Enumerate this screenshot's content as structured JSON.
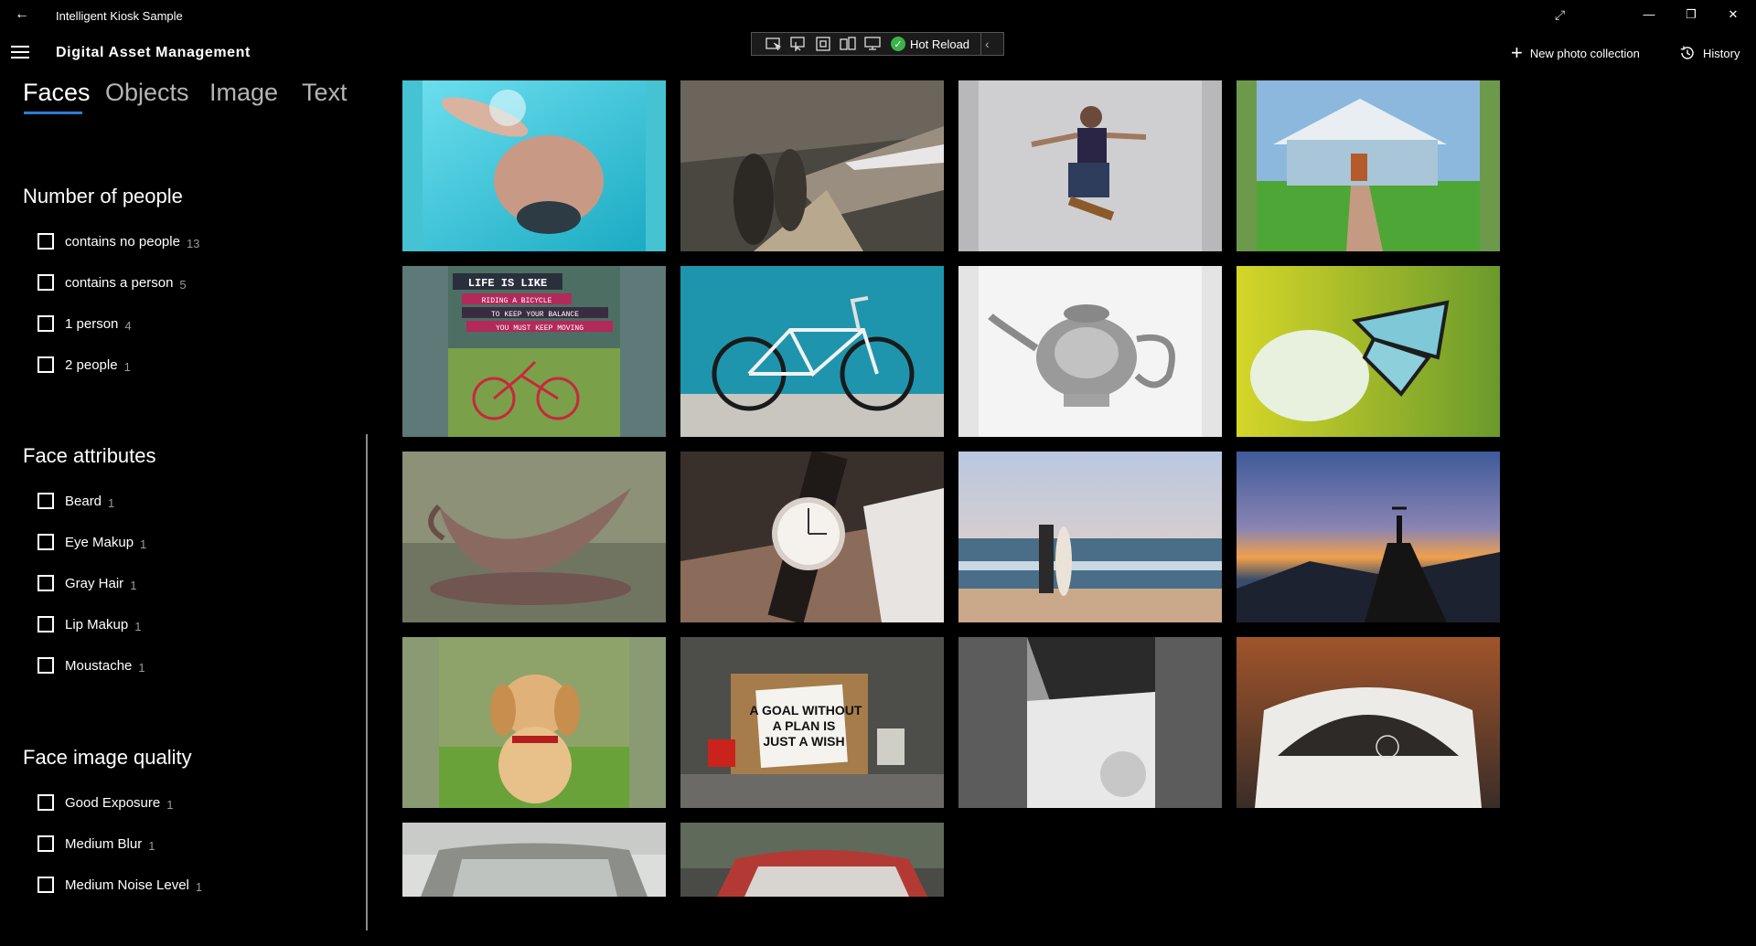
{
  "window": {
    "title": "Intelligent Kiosk Sample",
    "back_icon": "back-arrow-icon",
    "expand_icon": "expand-icon",
    "minimize_icon": "minimize-icon",
    "maximize_icon": "maximize-icon",
    "close_icon": "close-icon"
  },
  "header": {
    "menu_icon": "hamburger-icon",
    "app_title": "Digital Asset Management",
    "hot_reload_label": "Hot Reload",
    "new_collection_label": "New photo collection",
    "history_label": "History"
  },
  "tabs": [
    {
      "label": "Faces",
      "active": true
    },
    {
      "label": "Objects",
      "active": false
    },
    {
      "label": "Image",
      "active": false
    },
    {
      "label": "Text",
      "active": false
    }
  ],
  "filters": {
    "number_of_people": {
      "title": "Number of people",
      "items": [
        {
          "label": "contains no people",
          "count": "13"
        },
        {
          "label": "contains a person",
          "count": "5"
        },
        {
          "label": "1 person",
          "count": "4"
        },
        {
          "label": "2 people",
          "count": "1"
        }
      ]
    },
    "face_attributes": {
      "title": "Face attributes",
      "items": [
        {
          "label": "Beard",
          "count": "1"
        },
        {
          "label": "Eye Makup",
          "count": "1"
        },
        {
          "label": "Gray Hair",
          "count": "1"
        },
        {
          "label": "Lip Makup",
          "count": "1"
        },
        {
          "label": "Moustache",
          "count": "1"
        }
      ]
    },
    "face_image_quality": {
      "title": "Face image quality",
      "items": [
        {
          "label": "Good Exposure",
          "count": "1"
        },
        {
          "label": "Medium Blur",
          "count": "1"
        },
        {
          "label": "Medium Noise Level",
          "count": "1"
        }
      ]
    }
  },
  "photos": {
    "swimmer": {
      "poster_lines": []
    },
    "subway": {
      "poster_lines": []
    },
    "skateboarder": {
      "poster_lines": []
    },
    "house": {
      "poster_lines": []
    },
    "bicycle_poster": {
      "poster_lines": [
        "LIFE IS LIKE",
        "RIDING A BICYCLE",
        "TO KEEP YOUR BALANCE",
        "YOU MUST KEEP MOVING"
      ]
    },
    "bicycle_wall": {
      "poster_lines": []
    },
    "teapot": {
      "poster_lines": []
    },
    "butterfly": {
      "poster_lines": []
    },
    "gravy_boat": {
      "poster_lines": []
    },
    "wristwatch": {
      "poster_lines": []
    },
    "surfer": {
      "poster_lines": []
    },
    "mountain_sunset": {
      "poster_lines": []
    },
    "puppy": {
      "poster_lines": []
    },
    "goal_sign": {
      "poster_lines": [
        "A GOAL WITHOUT",
        "A PLAN IS",
        "JUST A WISH"
      ]
    },
    "white_car_side": {
      "poster_lines": []
    },
    "white_car_rear": {
      "poster_lines": []
    },
    "car_grey": {
      "poster_lines": []
    },
    "car_red": {
      "poster_lines": []
    }
  }
}
